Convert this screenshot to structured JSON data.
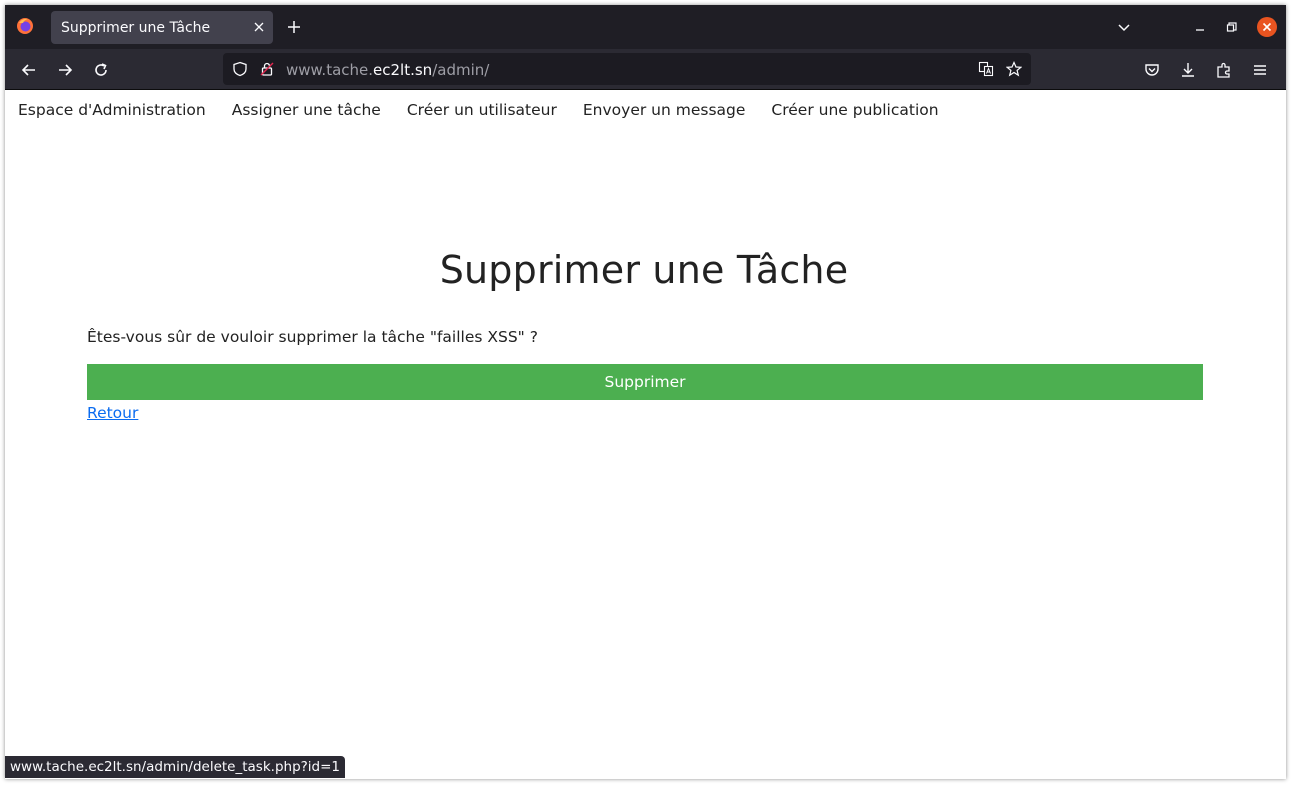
{
  "browser": {
    "tab_title": "Supprimer une Tâche",
    "url_prefix": "www.tache.",
    "url_host": "ec2lt.sn",
    "url_path": "/admin/",
    "status_url": "www.tache.ec2lt.sn/admin/delete_task.php?id=1",
    "icons": {
      "app": "firefox-logo-icon",
      "tab_close": "close-icon",
      "new_tab": "plus-icon",
      "tab_list": "chevron-down-icon",
      "back": "arrow-left-icon",
      "forward": "arrow-right-icon",
      "reload": "reload-icon",
      "tracking": "shield-icon",
      "security": "lock-icon",
      "translate": "translate-icon",
      "bookmark": "star-icon",
      "pocket": "pocket-icon",
      "downloads": "download-icon",
      "extensions": "puzzle-icon",
      "menu": "hamburger-menu-icon"
    }
  },
  "nav": {
    "items": [
      "Espace d'Administration",
      "Assigner une tâche",
      "Créer un utilisateur",
      "Envoyer un message",
      "Créer une publication"
    ]
  },
  "page": {
    "title": "Supprimer une Tâche",
    "confirm": "Êtes-vous sûr de vouloir supprimer la tâche \"failles XSS\" ?",
    "delete_label": "Supprimer",
    "back_label": "Retour"
  },
  "colors": {
    "delete_button": "#4caf50",
    "link": "#0b6cf0",
    "close_window": "#e95420"
  }
}
